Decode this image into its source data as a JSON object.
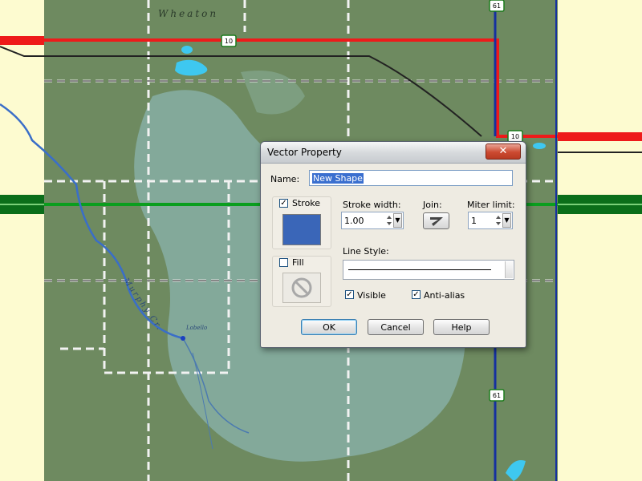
{
  "map": {
    "labels": {
      "wheaton": "Wheaton",
      "murphy_creek": "Murphy Cr.",
      "swamp": "Lobello"
    },
    "shields": {
      "route_top": "10",
      "route_right": "10",
      "route_north": "61",
      "route_south": "61"
    },
    "colors": {
      "land": "#6e8a60",
      "lake": "#87aea4",
      "outer": "#fdfbd0",
      "water": "#3a6ec8",
      "red_road": "#ee1a1a",
      "green_road": "#0a9e1e"
    }
  },
  "dialog": {
    "title": "Vector Property",
    "close_icon": "close-icon",
    "name_label": "Name:",
    "name_value": "New Shape",
    "stroke_label": "Stroke",
    "stroke_checked": true,
    "stroke_color": "#3a66b8",
    "fill_label": "Fill",
    "fill_checked": false,
    "fill_icon": "no-fill-icon",
    "stroke_width_label": "Stroke width:",
    "stroke_width_value": "1.00",
    "join_label": "Join:",
    "join_icon": "join-style-icon",
    "miter_label": "Miter limit:",
    "miter_value": "1",
    "line_style_label": "Line Style:",
    "visible_label": "Visible",
    "visible_checked": true,
    "antialias_label": "Anti-alias",
    "antialias_checked": true,
    "ok_label": "OK",
    "cancel_label": "Cancel",
    "help_label": "Help"
  }
}
